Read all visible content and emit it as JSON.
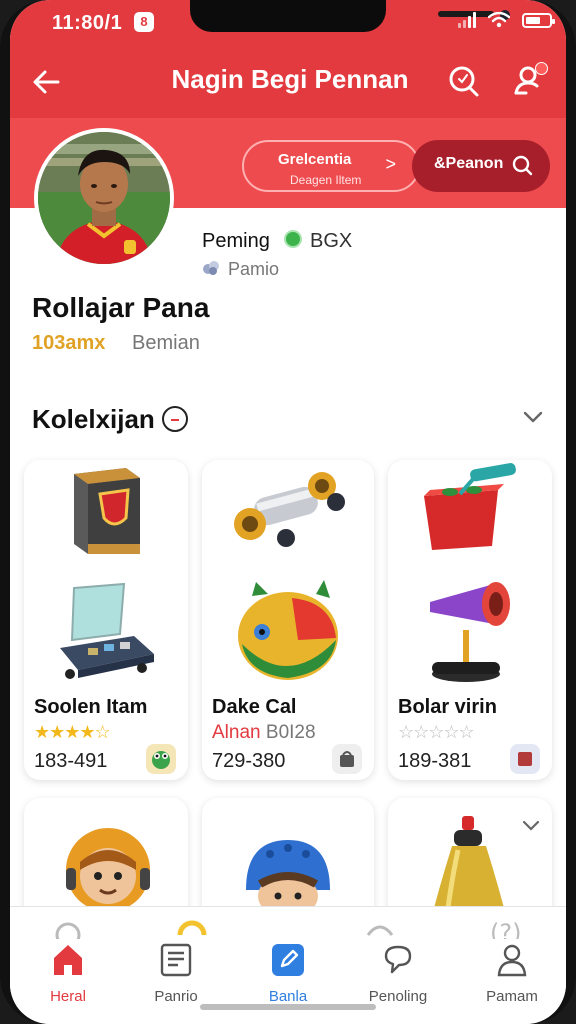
{
  "status_bar": {
    "time": "11:80/1",
    "badge": "8"
  },
  "header": {
    "title": "Nagin Begi Pennan"
  },
  "profile": {
    "pill_left_line1": "Grelcentia",
    "pill_left_line2": "Deagen Iltem",
    "pill_right_label": "&Peanon",
    "level_name": "Peming",
    "coin_text": "BGX",
    "sub_text": "Pamio",
    "name": "Rollajar Pana",
    "stat_value": "103amx",
    "stat_label": "Bemian"
  },
  "section": {
    "title": "Kolelxijan"
  },
  "items": [
    {
      "name": "Soolen Itam",
      "rating": "★★★★☆",
      "price": "183-491"
    },
    {
      "name": "Dake Cal",
      "subtitle_a": "Alnan",
      "subtitle_b": "B0I28",
      "price": "729-380"
    },
    {
      "name": "Bolar virin",
      "rating": "☆☆☆☆☆",
      "price": "189-381"
    }
  ],
  "bottom_nav": [
    {
      "label": "Heral"
    },
    {
      "label": "Panrio"
    },
    {
      "label": "Banla"
    },
    {
      "label": "Penoling"
    },
    {
      "label": "Pamam"
    }
  ],
  "colors": {
    "primary_red": "#e23a3f",
    "dark_red": "#a81f2c",
    "active_blue": "#2f7fe0",
    "star_gold": "#f2b81c"
  }
}
